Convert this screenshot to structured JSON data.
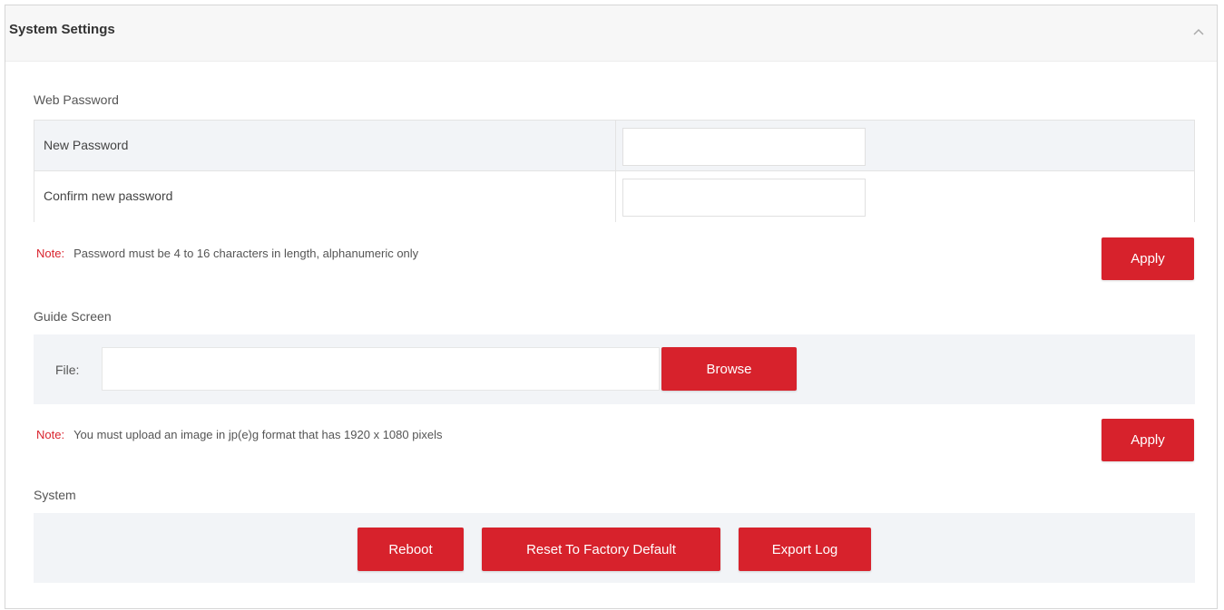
{
  "panel": {
    "title": "System Settings",
    "collapse_icon": "chevron-up-icon"
  },
  "web_password": {
    "section_title": "Web Password",
    "rows": [
      {
        "label": "New Password",
        "value": ""
      },
      {
        "label": "Confirm new password",
        "value": ""
      }
    ],
    "note_label": "Note:",
    "note_text": "Password must be 4 to 16 characters in length, alphanumeric only",
    "apply_label": "Apply"
  },
  "guide_screen": {
    "section_title": "Guide Screen",
    "file_label": "File:",
    "file_value": "",
    "browse_label": "Browse",
    "note_label": "Note:",
    "note_text": "You must upload an image in jp(e)g format that has 1920 x 1080 pixels",
    "apply_label": "Apply"
  },
  "system": {
    "section_title": "System",
    "reboot_label": "Reboot",
    "reset_label": "Reset To Factory Default",
    "export_label": "Export Log"
  },
  "colors": {
    "accent": "#d7222c",
    "row_bg": "#f2f4f7"
  }
}
